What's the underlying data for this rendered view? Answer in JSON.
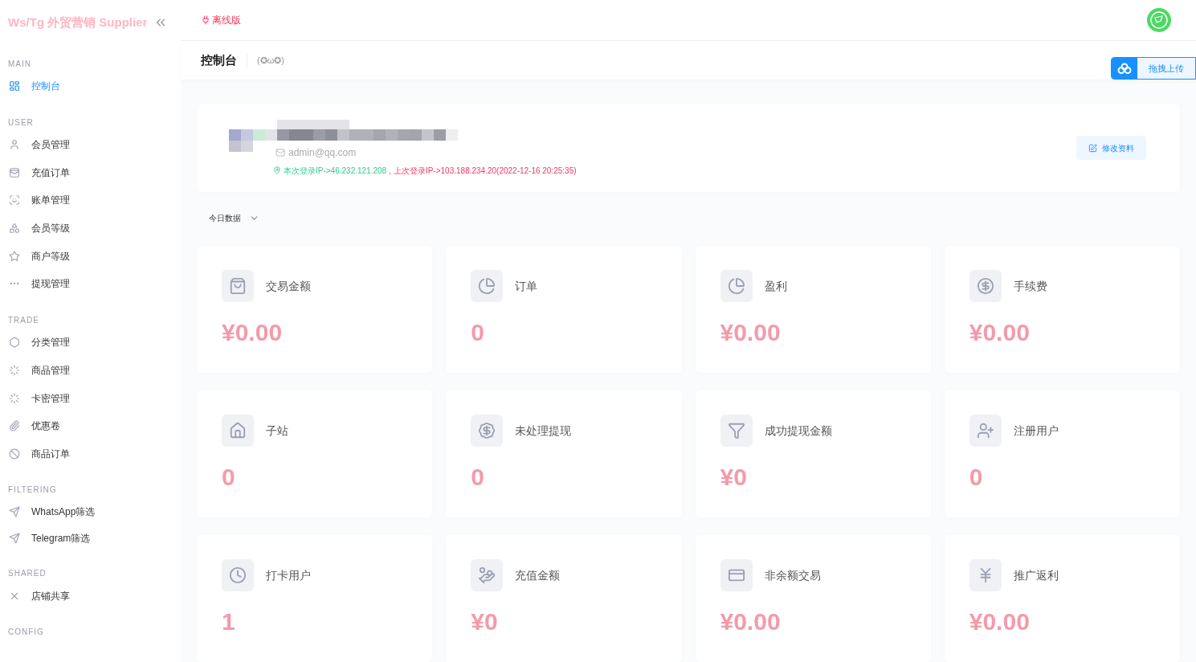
{
  "brand": {
    "title": "Ws/Tg 外贸营销 Supplier"
  },
  "header": {
    "badge": "离线版"
  },
  "page": {
    "title": "控制台",
    "subtitle": "(✪ω✪)"
  },
  "upload_tab": {
    "label": "拖拽上传"
  },
  "sidebar": {
    "sections": [
      {
        "heading": "MAIN",
        "items": [
          {
            "label": "控制台",
            "selected": true
          }
        ]
      },
      {
        "heading": "USER",
        "items": [
          {
            "label": "会员管理",
            "selected": false
          },
          {
            "label": "充值订单",
            "selected": false
          },
          {
            "label": "账单管理",
            "selected": false
          },
          {
            "label": "会员等级",
            "selected": false
          },
          {
            "label": "商户等级",
            "selected": false
          },
          {
            "label": "提现管理",
            "selected": false
          }
        ]
      },
      {
        "heading": "TRADE",
        "items": [
          {
            "label": "分类管理",
            "selected": false
          },
          {
            "label": "商品管理",
            "selected": false
          },
          {
            "label": "卡密管理",
            "selected": false
          },
          {
            "label": "优惠卷",
            "selected": false
          },
          {
            "label": "商品订单",
            "selected": false
          }
        ]
      },
      {
        "heading": "FILTERING",
        "items": [
          {
            "label": "WhatsApp筛选",
            "selected": false
          },
          {
            "label": "Telegram筛选",
            "selected": false
          }
        ]
      },
      {
        "heading": "SHARED",
        "items": [
          {
            "label": "店铺共享",
            "selected": false
          }
        ]
      },
      {
        "heading": "CONFIG"
      }
    ]
  },
  "profile": {
    "email": "admin@qq.com",
    "current_login": "本次登录IP->46.232.121.208",
    "separator": ",",
    "previous_login": "上次登录IP->103.188.234.20(2022-12-16 20:25:35)",
    "edit_button": "修改资料"
  },
  "period": {
    "label": "今日数据"
  },
  "stats": [
    {
      "label": "交易金额",
      "value": "¥0.00"
    },
    {
      "label": "订单",
      "value": "0"
    },
    {
      "label": "盈利",
      "value": "¥0.00"
    },
    {
      "label": "手续费",
      "value": "¥0.00"
    },
    {
      "label": "子站",
      "value": "0"
    },
    {
      "label": "未处理提现",
      "value": "0"
    },
    {
      "label": "成功提现金额",
      "value": "¥0"
    },
    {
      "label": "注册用户",
      "value": "0"
    },
    {
      "label": "打卡用户",
      "value": "1"
    },
    {
      "label": "充值金额",
      "value": "¥0"
    },
    {
      "label": "非余额交易",
      "value": "¥0.00"
    },
    {
      "label": "推广返利",
      "value": "¥0.00"
    }
  ]
}
